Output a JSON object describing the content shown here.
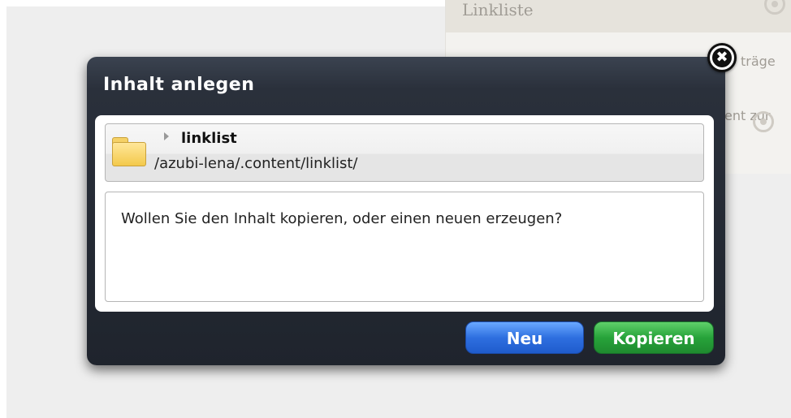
{
  "background": {
    "panel_title": "Linkliste",
    "partial_text_1": "träge",
    "partial_text_2": "ent zur"
  },
  "dialog": {
    "title": "Inhalt anlegen",
    "resource": {
      "name": "linklist",
      "path": "/azubi-lena/.content/linklist/",
      "icon": "folder-icon"
    },
    "message": "Wollen Sie den Inhalt kopieren, oder einen neuen erzeugen?",
    "buttons": {
      "new_label": "Neu",
      "copy_label": "Kopieren"
    },
    "close_glyph": "✖"
  },
  "colors": {
    "dialog_bg": "#1f242d",
    "button_blue": "#2e6fe0",
    "button_green": "#27a33a"
  }
}
